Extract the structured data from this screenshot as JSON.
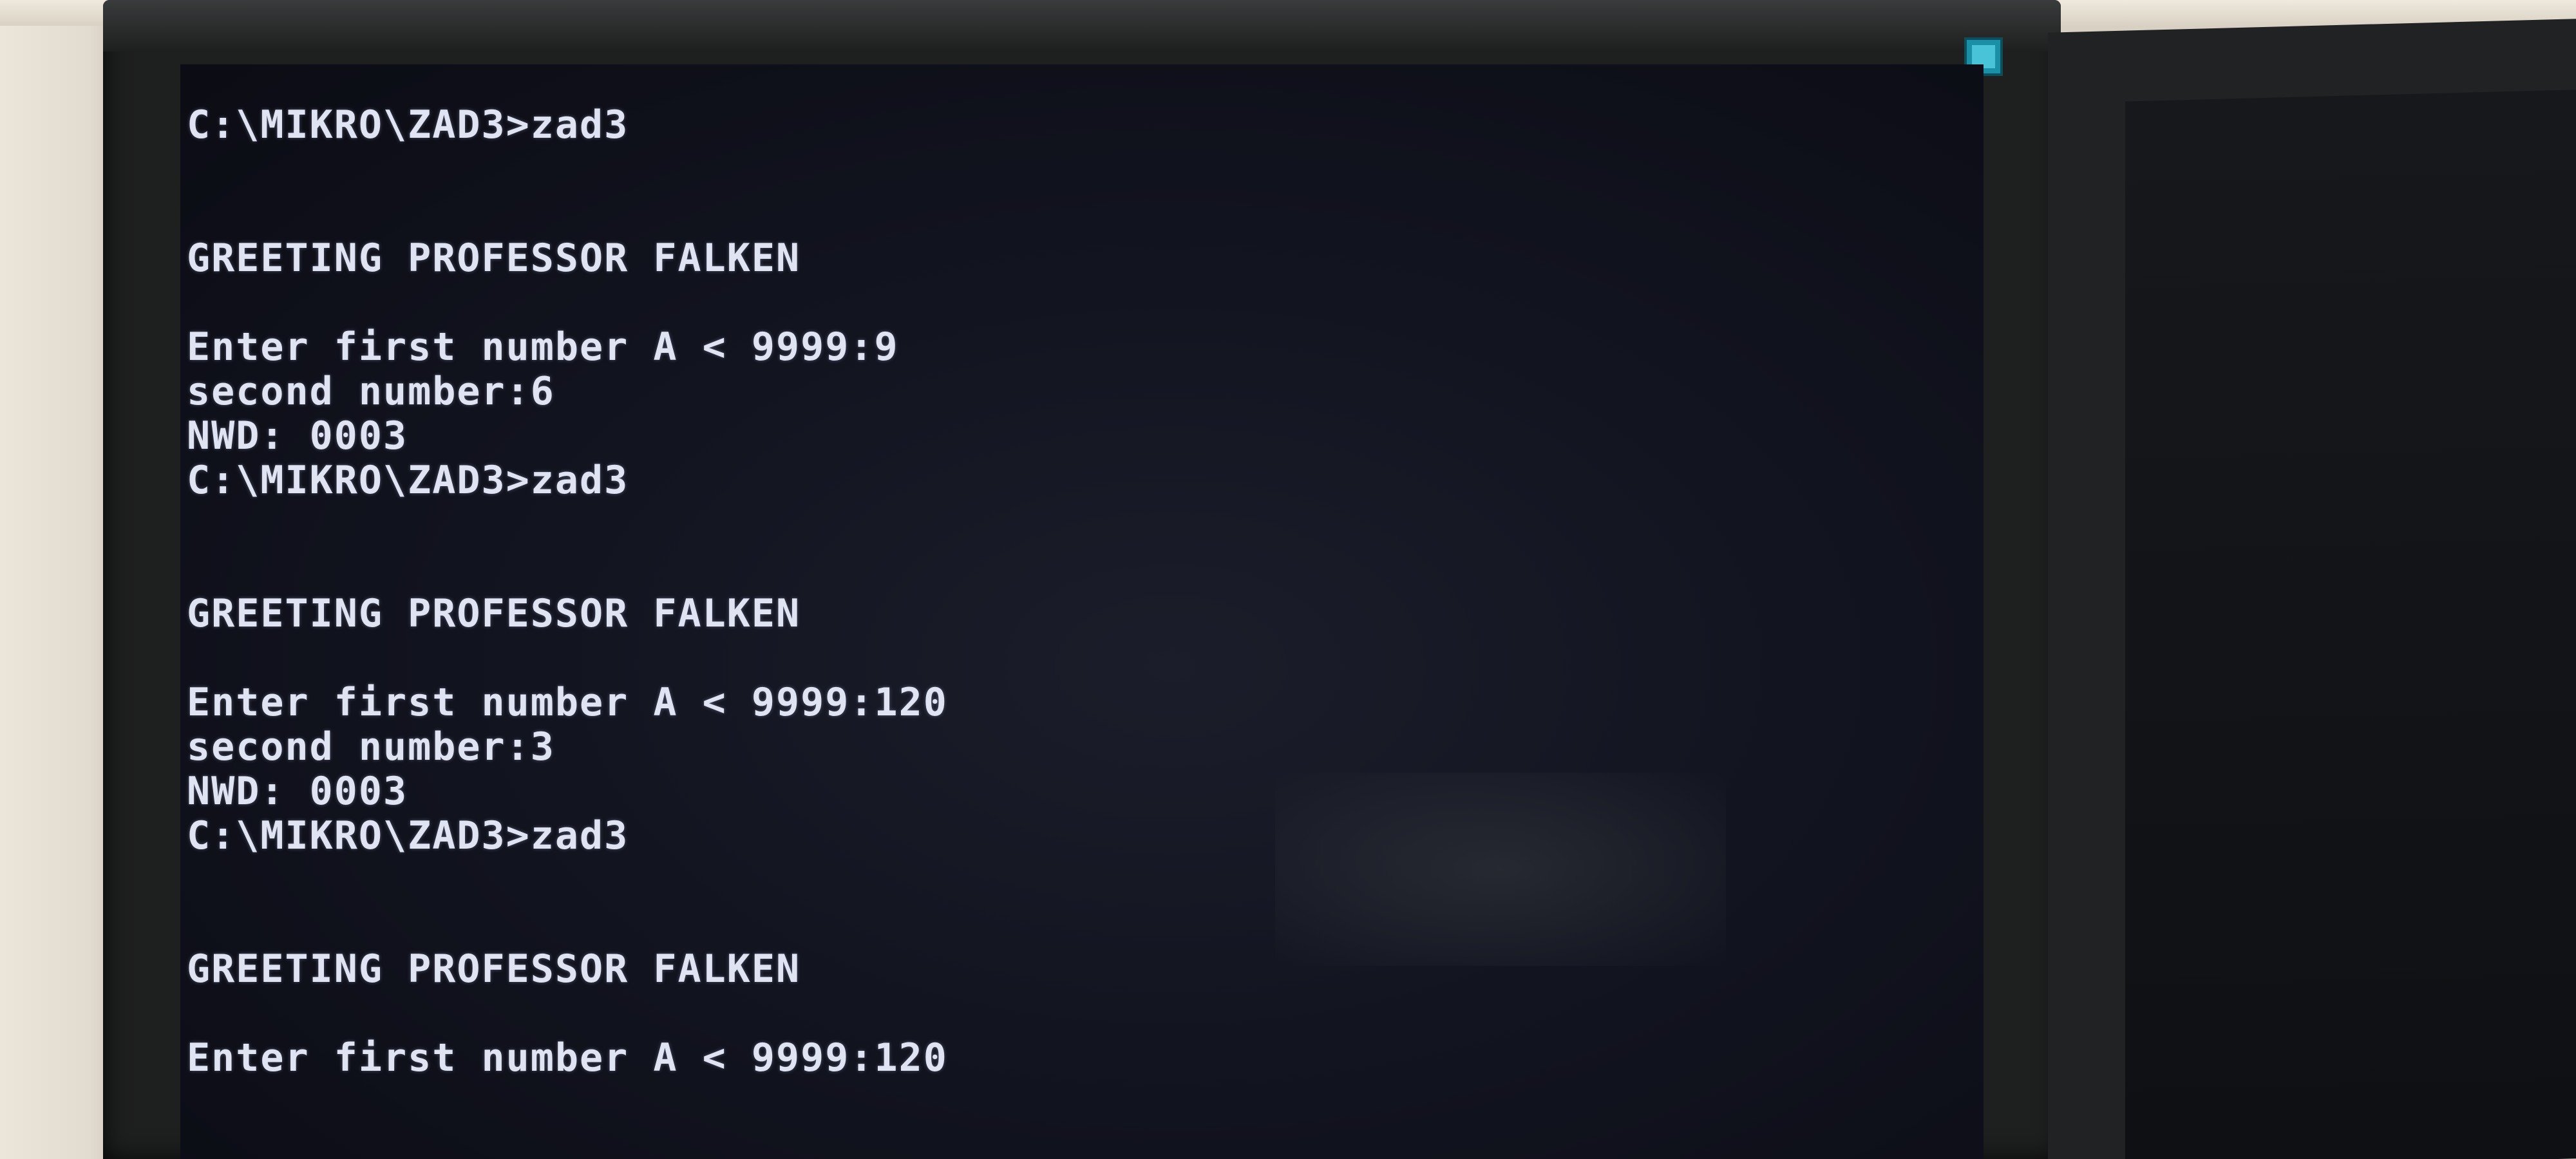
{
  "terminal": {
    "lines": [
      "C:\\MIKRO\\ZAD3>zad3",
      "",
      "",
      "GREETING PROFESSOR FALKEN",
      "",
      "Enter first number A < 9999:9",
      "second number:6",
      "NWD: 0003",
      "C:\\MIKRO\\ZAD3>zad3",
      "",
      "",
      "GREETING PROFESSOR FALKEN",
      "",
      "Enter first number A < 9999:120",
      "second number:3",
      "NWD: 0003",
      "C:\\MIKRO\\ZAD3>zad3",
      "",
      "",
      "GREETING PROFESSOR FALKEN",
      "",
      "Enter first number A < 9999:120"
    ]
  },
  "colors": {
    "screen_background": "#121420",
    "text": "#dfe3f2",
    "bezel": "#1e1f1f",
    "power_led": "#1a8fa5"
  }
}
